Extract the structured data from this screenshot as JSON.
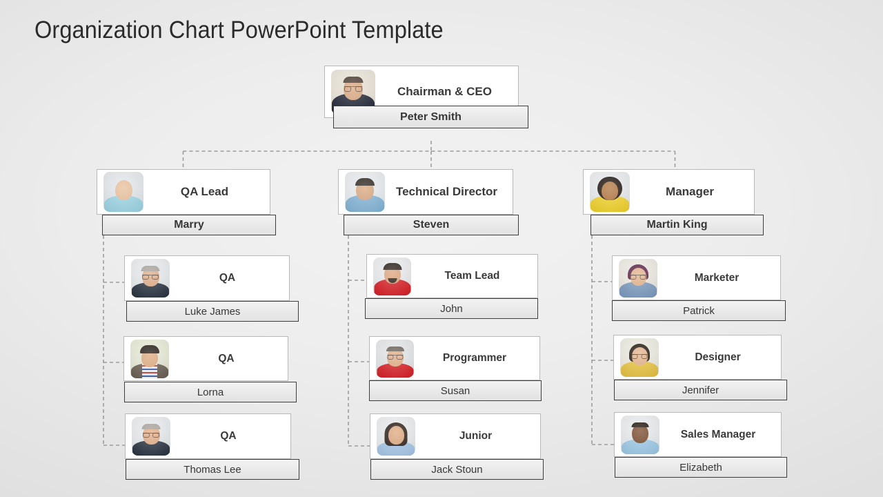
{
  "page": {
    "title": "Organization Chart PowerPoint Template",
    "background_color": "#e9e9e9"
  },
  "chart_data": {
    "type": "diagram",
    "diagram_type": "organization-chart",
    "title": "Organization Chart PowerPoint Template",
    "levels": 3,
    "connector_style": "dashed",
    "connector_color": "#9a9a9a",
    "card_background": "#ffffff",
    "card_border_color": "#b9b9b9",
    "namebar_background": "#ebebeb",
    "namebar_border_color": "#3d3d3d",
    "nodes": [
      {
        "id": "ceo",
        "level": 1,
        "role": "Chairman  & CEO",
        "name": "Peter Smith",
        "parent": null,
        "photo": "portrait-man-bald-glasses-suit"
      },
      {
        "id": "qa-lead",
        "level": 2,
        "role": "QA Lead",
        "name": "Marry",
        "parent": "ceo",
        "photo": "portrait-woman-blonde-blue-top"
      },
      {
        "id": "tech-director",
        "level": 2,
        "role": "Technical Director",
        "name": "Steven",
        "parent": "ceo",
        "photo": "portrait-man-dark-hair-blue-shirt"
      },
      {
        "id": "manager",
        "level": 2,
        "role": "Manager",
        "name": "Martin King",
        "parent": "ceo",
        "photo": "portrait-woman-curly-yellow-top"
      },
      {
        "id": "qa-1",
        "level": 3,
        "role": "QA",
        "name": "Luke James",
        "parent": "qa-lead",
        "photo": "portrait-man-gray-hair-glasses-navy"
      },
      {
        "id": "qa-2",
        "level": 3,
        "role": "QA",
        "name": "Lorna",
        "parent": "qa-lead",
        "photo": "portrait-man-young-striped-shirt"
      },
      {
        "id": "qa-3",
        "level": 3,
        "role": "QA",
        "name": "Thomas Lee",
        "parent": "qa-lead",
        "photo": "portrait-man-gray-hair-glasses-navy"
      },
      {
        "id": "team-lead",
        "level": 3,
        "role": "Team Lead",
        "name": "John",
        "parent": "tech-director",
        "photo": "portrait-man-beard-red-polo"
      },
      {
        "id": "programmer",
        "level": 3,
        "role": "Programmer",
        "name": "Susan",
        "parent": "tech-director",
        "photo": "portrait-man-glasses-red-shirt"
      },
      {
        "id": "junior",
        "level": 3,
        "role": "Junior",
        "name": "Jack Stoun",
        "parent": "tech-director",
        "photo": "portrait-woman-dark-hair-light-blue"
      },
      {
        "id": "marketer",
        "level": 3,
        "role": "Marketer",
        "name": "Patrick",
        "parent": "manager",
        "photo": "portrait-woman-glasses-denim-shirt"
      },
      {
        "id": "designer",
        "level": 3,
        "role": "Designer",
        "name": "Jennifer",
        "parent": "manager",
        "photo": "portrait-woman-glasses-yellow-top"
      },
      {
        "id": "sales-manager",
        "level": 3,
        "role": "Sales Manager",
        "name": "Elizabeth",
        "parent": "manager",
        "photo": "portrait-man-bald-light-blue-shirt"
      }
    ]
  }
}
